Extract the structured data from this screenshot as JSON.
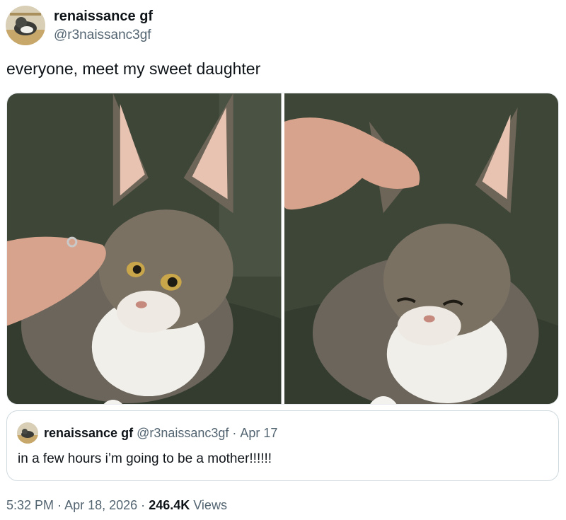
{
  "author": {
    "display_name": "renaissance gf",
    "handle": "@r3naissanc3gf",
    "avatar_icon": "cat-avatar-icon"
  },
  "tweet": {
    "text": "everyone, meet my sweet daughter",
    "photos": [
      {
        "icon": "cat-photo-eyes-open"
      },
      {
        "icon": "cat-photo-eyes-closed"
      }
    ]
  },
  "quoted_tweet": {
    "display_name": "renaissance gf",
    "handle": "@r3naissanc3gf",
    "separator": "·",
    "date": "Apr 17",
    "text": "in a few hours i’m going to be a mother!!!!!!"
  },
  "meta": {
    "time": "5:32 PM",
    "separator": "·",
    "date": "Apr 18, 2026",
    "separator2": "·",
    "views_count": "246.4K",
    "views_label": "Views"
  },
  "colors": {
    "text_primary": "#0f1419",
    "text_secondary": "#536471",
    "border": "#cfd9de"
  }
}
